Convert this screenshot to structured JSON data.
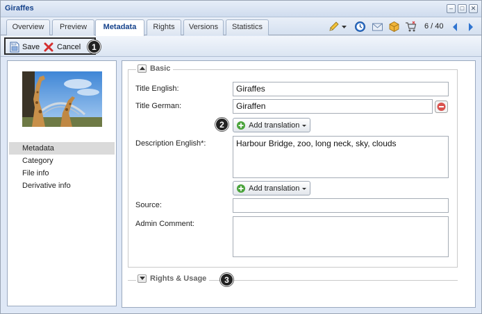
{
  "window": {
    "title": "Giraffes"
  },
  "tabs": [
    {
      "label": "Overview"
    },
    {
      "label": "Preview"
    },
    {
      "label": "Metadata"
    },
    {
      "label": "Rights"
    },
    {
      "label": "Versions"
    },
    {
      "label": "Statistics"
    }
  ],
  "tab_toolbar": {
    "icons": [
      "pencil-icon",
      "dropdown-arrow-icon",
      "clock-icon",
      "mail-icon",
      "package-icon",
      "cart-icon"
    ],
    "pager": "6 / 40"
  },
  "toolbar": {
    "save_label": "Save",
    "cancel_label": "Cancel"
  },
  "callouts": [
    "1",
    "2",
    "3"
  ],
  "sidebar": {
    "items": [
      {
        "label": "Metadata",
        "selected": true
      },
      {
        "label": "Category"
      },
      {
        "label": "File info"
      },
      {
        "label": "Derivative info"
      }
    ]
  },
  "basic": {
    "legend": "Basic",
    "title_en_label": "Title English:",
    "title_en_value": "Giraffes",
    "title_de_label": "Title German:",
    "title_de_value": "Giraffen",
    "add_translation_label": "Add translation",
    "desc_en_label": "Description English*:",
    "desc_en_value": "Harbour Bridge, zoo, long neck, sky, clouds",
    "source_label": "Source:",
    "source_value": "",
    "admin_comment_label": "Admin Comment:",
    "admin_comment_value": ""
  },
  "rights": {
    "legend": "Rights & Usage"
  },
  "colors": {
    "accent": "#15428b",
    "window_bg": "#dfe8f6",
    "remove": "#d9534f",
    "add": "#4aa33b"
  }
}
